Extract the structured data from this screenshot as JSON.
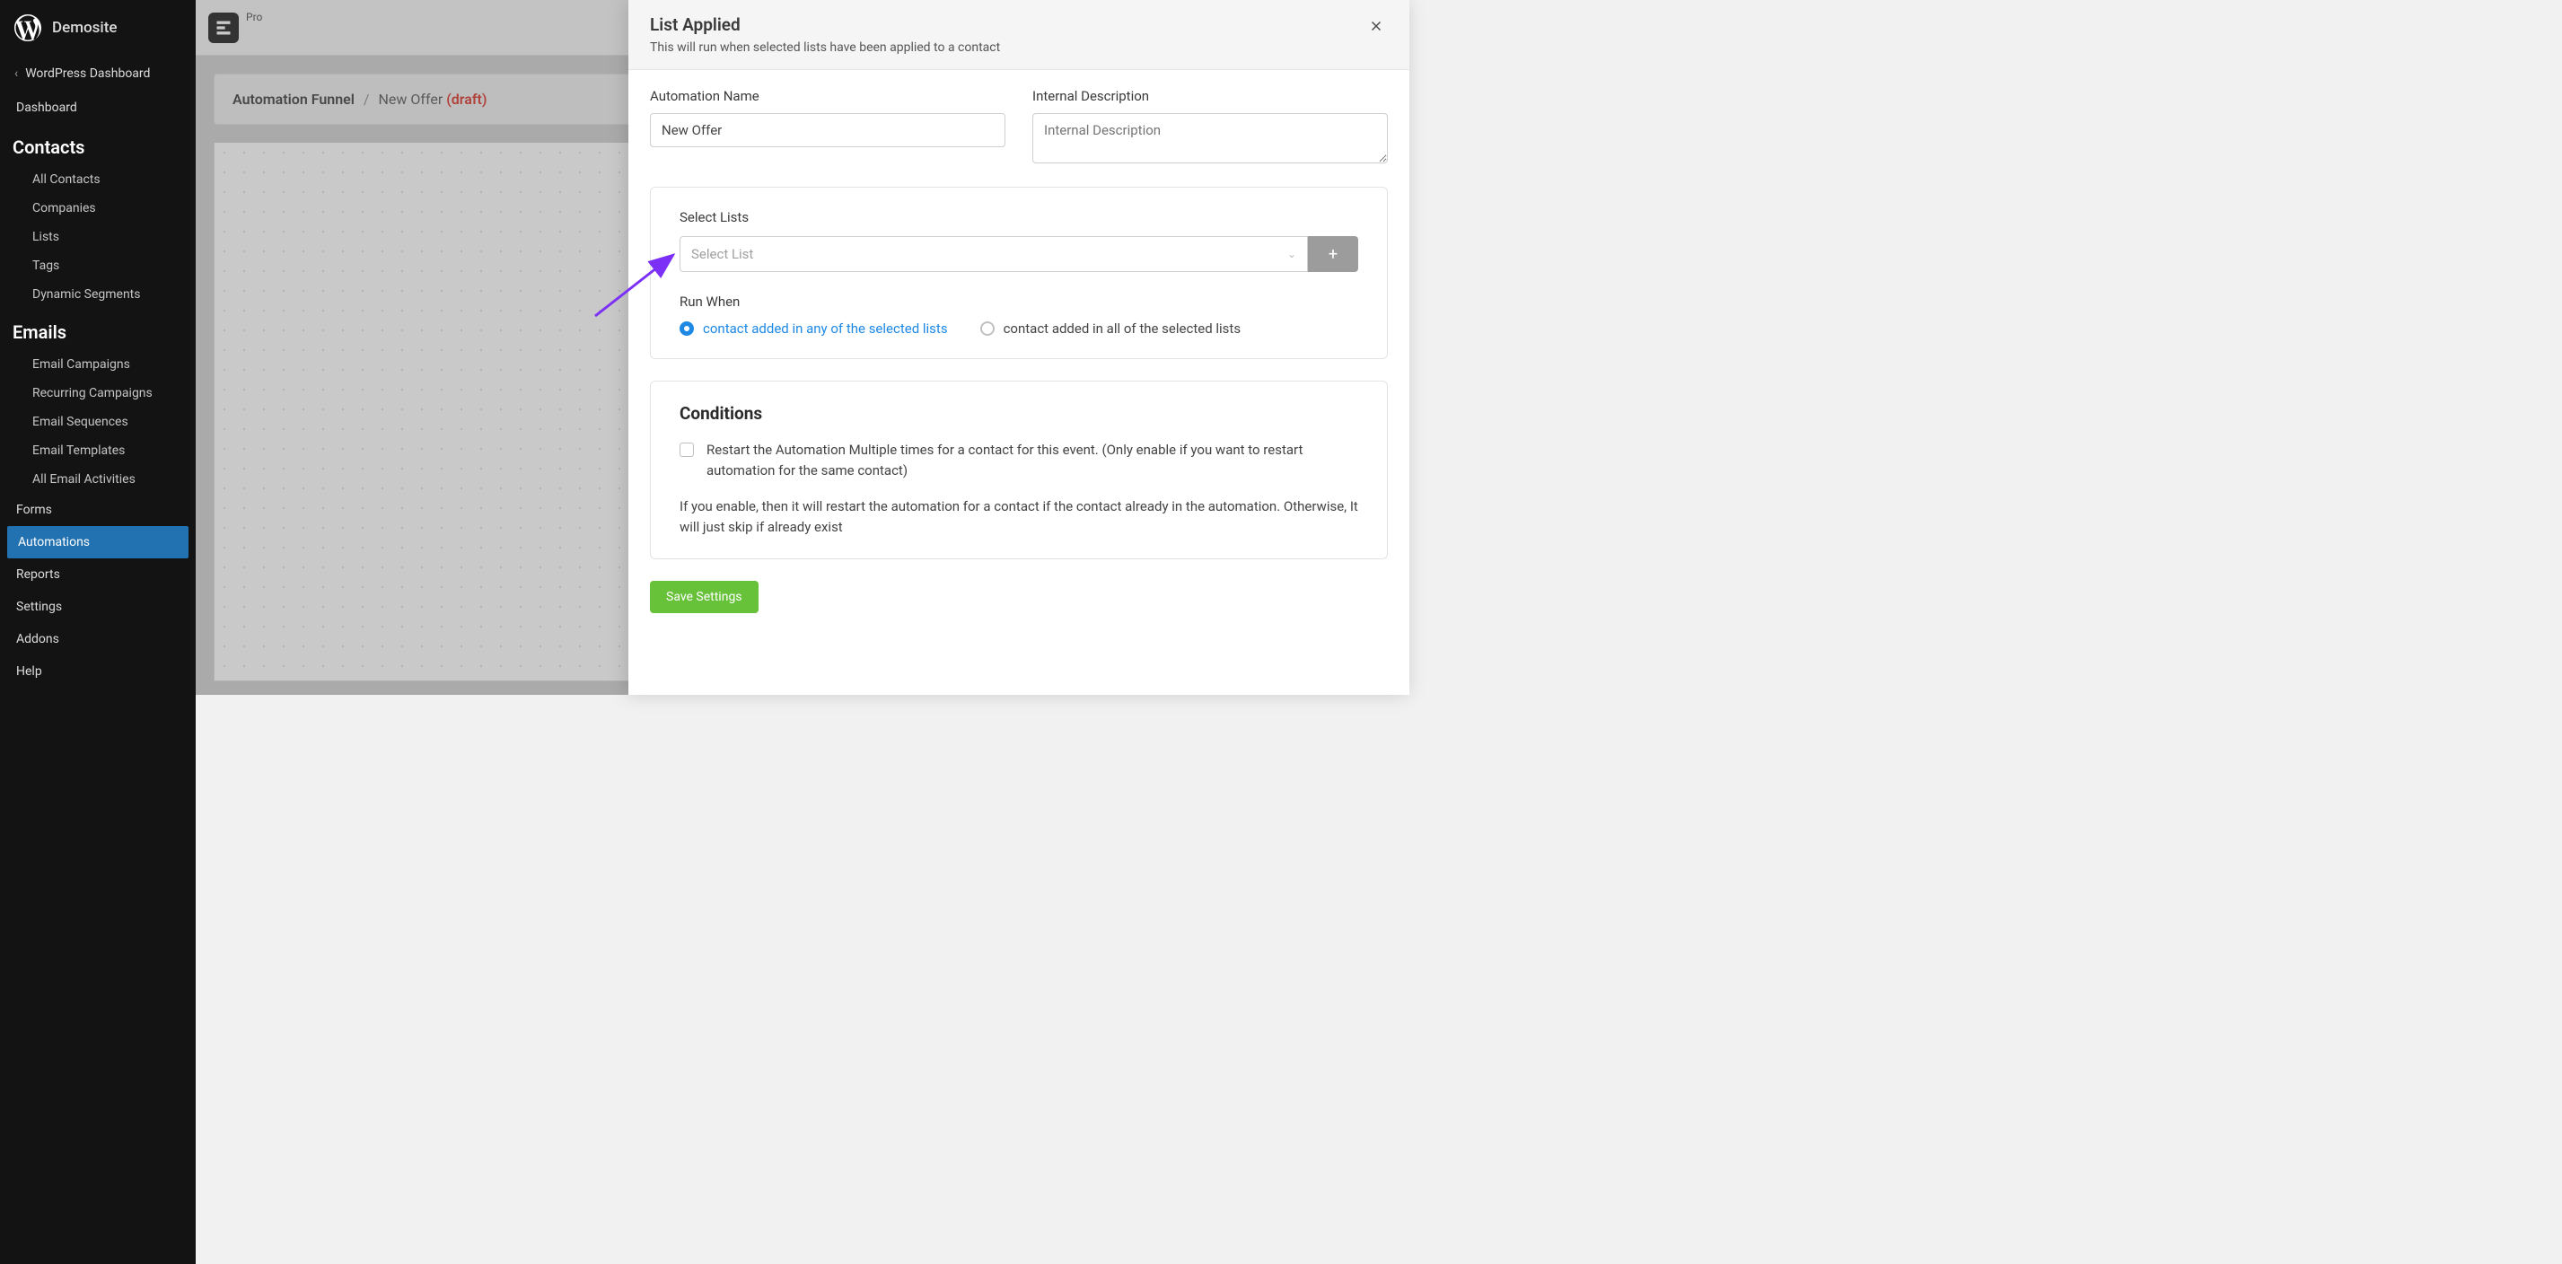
{
  "site": {
    "title": "Demosite",
    "back_link": "WordPress Dashboard"
  },
  "nav": {
    "dashboard": "Dashboard",
    "contacts_heading": "Contacts",
    "contacts": {
      "all": "All Contacts",
      "companies": "Companies",
      "lists": "Lists",
      "tags": "Tags",
      "dynamic_segments": "Dynamic Segments"
    },
    "emails_heading": "Emails",
    "emails": {
      "campaigns": "Email Campaigns",
      "recurring": "Recurring Campaigns",
      "sequences": "Email Sequences",
      "templates": "Email Templates",
      "activities": "All Email Activities"
    },
    "forms": "Forms",
    "automations": "Automations",
    "reports": "Reports",
    "settings": "Settings",
    "addons": "Addons",
    "help": "Help"
  },
  "topbar": {
    "pro": "Pro"
  },
  "breadcrumb": {
    "funnel": "Automation Funnel",
    "sep": "/",
    "name": "New Offer",
    "draft": "(draft)"
  },
  "panel": {
    "title": "List Applied",
    "subtitle": "This will run when selected lists have been applied to a contact",
    "automation_name_label": "Automation Name",
    "automation_name_value": "New Offer",
    "internal_desc_label": "Internal Description",
    "internal_desc_placeholder": "Internal Description",
    "select_lists_label": "Select Lists",
    "select_list_placeholder": "Select List",
    "add_btn": "+",
    "run_when_label": "Run When",
    "radio_any": "contact added in any of the selected lists",
    "radio_all": "contact added in all of the selected lists",
    "conditions_title": "Conditions",
    "restart_label": "Restart the Automation Multiple times for a contact for this event. (Only enable if you want to restart automation for the same contact)",
    "restart_helper": "If you enable, then it will restart the automation for a contact if the contact already in the automation. Otherwise, It will just skip if already exist",
    "save_btn": "Save Settings"
  }
}
